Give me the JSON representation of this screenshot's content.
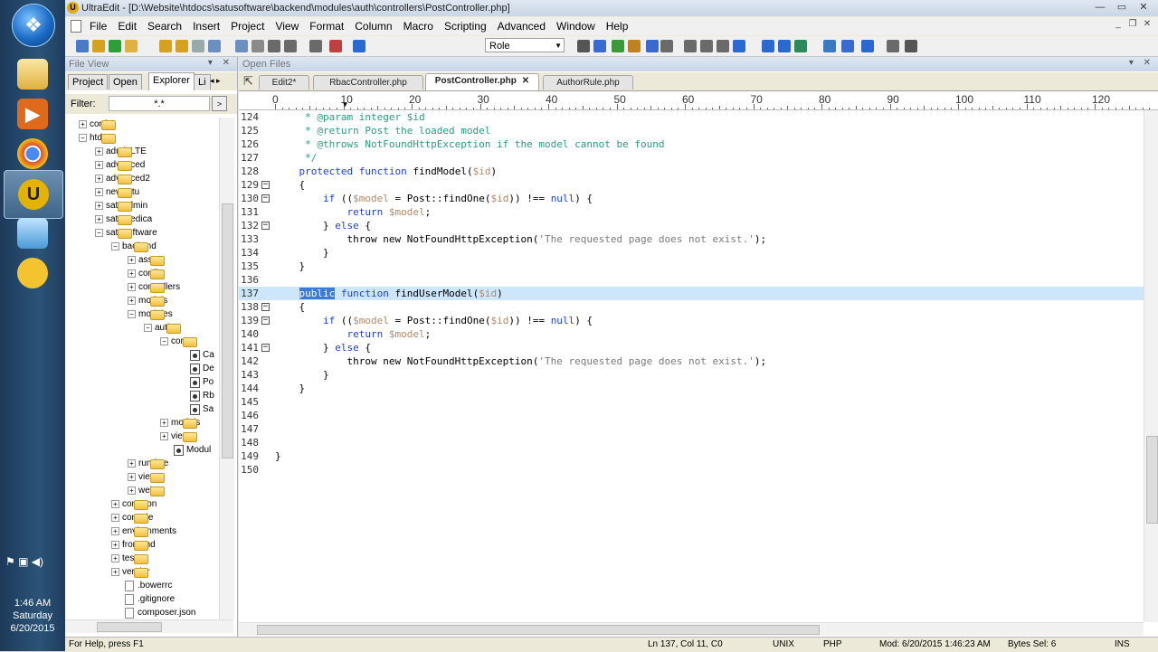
{
  "taskbar": {
    "start_glyph": "❖",
    "clock": {
      "time": "1:46 AM",
      "day": "Saturday",
      "date": "6/20/2015"
    },
    "tray_icons": [
      "flag-icon",
      "network-icon",
      "volume-icon"
    ]
  },
  "window": {
    "title": "UltraEdit - [D:\\Website\\htdocs\\satusoftware\\backend\\modules\\auth\\controllers\\PostController.php]",
    "app_icon_glyph": "U"
  },
  "menu": [
    "File",
    "Edit",
    "Search",
    "Insert",
    "Project",
    "View",
    "Format",
    "Column",
    "Macro",
    "Scripting",
    "Advanced",
    "Window",
    "Help"
  ],
  "toolbar": {
    "combo_value": "Role"
  },
  "fileview": {
    "title": "File View",
    "tabs": [
      "Project",
      "Open",
      "Explorer",
      "Li"
    ],
    "filter_label": "Filter:",
    "filter_value": "*.*",
    "tree": [
      {
        "label": "conf",
        "type": "folder",
        "level": 0,
        "exp": "+"
      },
      {
        "label": "htdocs",
        "type": "folder",
        "level": 0,
        "exp": "-"
      },
      {
        "label": "adminLTE",
        "type": "folder",
        "level": 1,
        "exp": "+"
      },
      {
        "label": "advanced",
        "type": "folder",
        "level": 1,
        "exp": "+"
      },
      {
        "label": "advanced2",
        "type": "folder",
        "level": 1,
        "exp": "+"
      },
      {
        "label": "newsatu",
        "type": "folder",
        "level": 1,
        "exp": "+"
      },
      {
        "label": "satuadmin",
        "type": "folder",
        "level": 1,
        "exp": "+"
      },
      {
        "label": "satumedica",
        "type": "folder",
        "level": 1,
        "exp": "+"
      },
      {
        "label": "satusoftware",
        "type": "folder",
        "level": 1,
        "exp": "-"
      },
      {
        "label": "backend",
        "type": "folder",
        "level": 2,
        "exp": "-"
      },
      {
        "label": "assets",
        "type": "folder",
        "level": 3,
        "exp": "+"
      },
      {
        "label": "config",
        "type": "folder",
        "level": 3,
        "exp": "+"
      },
      {
        "label": "controllers",
        "type": "folder",
        "level": 3,
        "exp": "+"
      },
      {
        "label": "models",
        "type": "folder",
        "level": 3,
        "exp": "+"
      },
      {
        "label": "modules",
        "type": "folder",
        "level": 3,
        "exp": "-"
      },
      {
        "label": "auth",
        "type": "folder",
        "level": 4,
        "exp": "-"
      },
      {
        "label": "contro",
        "type": "folder",
        "level": 5,
        "exp": "-"
      },
      {
        "label": "Ca",
        "type": "php",
        "level": 6,
        "exp": ""
      },
      {
        "label": "De",
        "type": "php",
        "level": 6,
        "exp": ""
      },
      {
        "label": "Po",
        "type": "php",
        "level": 6,
        "exp": ""
      },
      {
        "label": "Rb",
        "type": "php",
        "level": 6,
        "exp": ""
      },
      {
        "label": "Sa",
        "type": "php",
        "level": 6,
        "exp": ""
      },
      {
        "label": "models",
        "type": "folder",
        "level": 5,
        "exp": "+"
      },
      {
        "label": "views",
        "type": "folder",
        "level": 5,
        "exp": "+"
      },
      {
        "label": "Modul",
        "type": "php",
        "level": 5,
        "exp": ""
      },
      {
        "label": "runtime",
        "type": "folder",
        "level": 3,
        "exp": "+"
      },
      {
        "label": "views",
        "type": "folder",
        "level": 3,
        "exp": "+"
      },
      {
        "label": "web",
        "type": "folder",
        "level": 3,
        "exp": "+"
      },
      {
        "label": "common",
        "type": "folder",
        "level": 2,
        "exp": "+"
      },
      {
        "label": "console",
        "type": "folder",
        "level": 2,
        "exp": "+"
      },
      {
        "label": "environments",
        "type": "folder",
        "level": 2,
        "exp": "+"
      },
      {
        "label": "frontend",
        "type": "folder",
        "level": 2,
        "exp": "+"
      },
      {
        "label": "tests",
        "type": "folder",
        "level": 2,
        "exp": "+"
      },
      {
        "label": "vendor",
        "type": "folder",
        "level": 2,
        "exp": "+"
      },
      {
        "label": ".bowerrc",
        "type": "file",
        "level": 2,
        "exp": ""
      },
      {
        "label": ".gitignore",
        "type": "file",
        "level": 2,
        "exp": ""
      },
      {
        "label": "composer.json",
        "type": "file",
        "level": 2,
        "exp": ""
      }
    ]
  },
  "openfiles": {
    "title": "Open Files",
    "tabs": [
      {
        "label": "Edit2*",
        "active": false
      },
      {
        "label": "RbacController.php",
        "active": false
      },
      {
        "label": "PostController.php",
        "active": true,
        "close": "✕"
      },
      {
        "label": "AuthorRule.php",
        "active": false
      }
    ]
  },
  "ruler": [
    "0",
    "10",
    "20",
    "30",
    "40",
    "50",
    "60",
    "70",
    "80",
    "90",
    "100",
    "110",
    "120"
  ],
  "code": [
    {
      "n": "124",
      "fold": "",
      "hl": false,
      "parts": [
        [
          "cm",
          "     * @param integer $id"
        ]
      ]
    },
    {
      "n": "125",
      "fold": "",
      "hl": false,
      "parts": [
        [
          "cm",
          "     * @return Post the loaded model"
        ]
      ]
    },
    {
      "n": "126",
      "fold": "",
      "hl": false,
      "parts": [
        [
          "cm",
          "     * @throws NotFoundHttpException if the model cannot be found"
        ]
      ]
    },
    {
      "n": "127",
      "fold": "",
      "hl": false,
      "parts": [
        [
          "cm",
          "     */"
        ]
      ]
    },
    {
      "n": "128",
      "fold": "",
      "hl": false,
      "parts": [
        [
          "",
          "    "
        ],
        [
          "k",
          "protected function"
        ],
        [
          "",
          " findModel("
        ],
        [
          "vr",
          "$id"
        ],
        [
          "",
          ")"
        ]
      ]
    },
    {
      "n": "129",
      "fold": "−",
      "hl": false,
      "parts": [
        [
          "",
          "    {"
        ]
      ]
    },
    {
      "n": "130",
      "fold": "−",
      "hl": false,
      "parts": [
        [
          "",
          "        "
        ],
        [
          "k",
          "if"
        ],
        [
          "",
          " (("
        ],
        [
          "vr",
          "$model"
        ],
        [
          "",
          " = Post::findOne("
        ],
        [
          "vr",
          "$id"
        ],
        [
          "",
          ")) !== "
        ],
        [
          "k",
          "null"
        ],
        [
          "",
          ") {"
        ]
      ]
    },
    {
      "n": "131",
      "fold": "",
      "hl": false,
      "parts": [
        [
          "",
          "            "
        ],
        [
          "k",
          "return"
        ],
        [
          "",
          " "
        ],
        [
          "vr",
          "$model"
        ],
        [
          "",
          ";"
        ]
      ]
    },
    {
      "n": "132",
      "fold": "−",
      "hl": false,
      "parts": [
        [
          "",
          "        } "
        ],
        [
          "k",
          "else"
        ],
        [
          "",
          " {"
        ]
      ]
    },
    {
      "n": "133",
      "fold": "",
      "hl": false,
      "parts": [
        [
          "",
          "            throw new NotFoundHttpException("
        ],
        [
          "st",
          "'The requested page does not exist.'"
        ],
        [
          "",
          ");"
        ]
      ]
    },
    {
      "n": "134",
      "fold": "",
      "hl": false,
      "parts": [
        [
          "",
          "        }"
        ]
      ]
    },
    {
      "n": "135",
      "fold": "",
      "hl": false,
      "parts": [
        [
          "",
          "    }"
        ]
      ]
    },
    {
      "n": "136",
      "fold": "",
      "hl": false,
      "parts": [
        [
          "",
          ""
        ]
      ]
    },
    {
      "n": "137",
      "fold": "",
      "hl": true,
      "parts": [
        [
          "",
          "    "
        ],
        [
          "sel",
          "public"
        ],
        [
          "",
          " "
        ],
        [
          "k",
          "function"
        ],
        [
          "",
          " findUserModel("
        ],
        [
          "vr",
          "$id"
        ],
        [
          "",
          ")"
        ]
      ]
    },
    {
      "n": "138",
      "fold": "−",
      "hl": false,
      "parts": [
        [
          "",
          "    {"
        ]
      ]
    },
    {
      "n": "139",
      "fold": "−",
      "hl": false,
      "parts": [
        [
          "",
          "        "
        ],
        [
          "k",
          "if"
        ],
        [
          "",
          " (("
        ],
        [
          "vr",
          "$model"
        ],
        [
          "",
          " = Post::findOne("
        ],
        [
          "vr",
          "$id"
        ],
        [
          "",
          ")) !== "
        ],
        [
          "k",
          "null"
        ],
        [
          "",
          ") {"
        ]
      ]
    },
    {
      "n": "140",
      "fold": "",
      "hl": false,
      "parts": [
        [
          "",
          "            "
        ],
        [
          "k",
          "return"
        ],
        [
          "",
          " "
        ],
        [
          "vr",
          "$model"
        ],
        [
          "",
          ";"
        ]
      ]
    },
    {
      "n": "141",
      "fold": "−",
      "hl": false,
      "parts": [
        [
          "",
          "        } "
        ],
        [
          "k",
          "else"
        ],
        [
          "",
          " {"
        ]
      ]
    },
    {
      "n": "142",
      "fold": "",
      "hl": false,
      "parts": [
        [
          "",
          "            throw new NotFoundHttpException("
        ],
        [
          "st",
          "'The requested page does not exist.'"
        ],
        [
          "",
          ");"
        ]
      ]
    },
    {
      "n": "143",
      "fold": "",
      "hl": false,
      "parts": [
        [
          "",
          "        }"
        ]
      ]
    },
    {
      "n": "144",
      "fold": "",
      "hl": false,
      "parts": [
        [
          "",
          "    }"
        ]
      ]
    },
    {
      "n": "145",
      "fold": "",
      "hl": false,
      "parts": [
        [
          "",
          ""
        ]
      ]
    },
    {
      "n": "146",
      "fold": "",
      "hl": false,
      "parts": [
        [
          "",
          ""
        ]
      ]
    },
    {
      "n": "147",
      "fold": "",
      "hl": false,
      "parts": [
        [
          "",
          ""
        ]
      ]
    },
    {
      "n": "148",
      "fold": "",
      "hl": false,
      "parts": [
        [
          "",
          ""
        ]
      ]
    },
    {
      "n": "149",
      "fold": "",
      "hl": false,
      "parts": [
        [
          "",
          "}"
        ]
      ]
    },
    {
      "n": "150",
      "fold": "",
      "hl": false,
      "parts": [
        [
          "",
          ""
        ]
      ]
    }
  ],
  "status": {
    "help": "For Help, press F1",
    "position": "Ln 137, Col 11, C0",
    "lineend": "UNIX",
    "lang": "PHP",
    "modified": "Mod: 6/20/2015 1:46:23 AM",
    "bytes": "Bytes Sel: 6",
    "mode": "INS"
  },
  "colors": {
    "keyword": "#1a3fd6",
    "comment": "#2a9a7f",
    "variable": "#b08a6a",
    "selection": "#3c7ad8",
    "current_line": "#cde6fa"
  }
}
